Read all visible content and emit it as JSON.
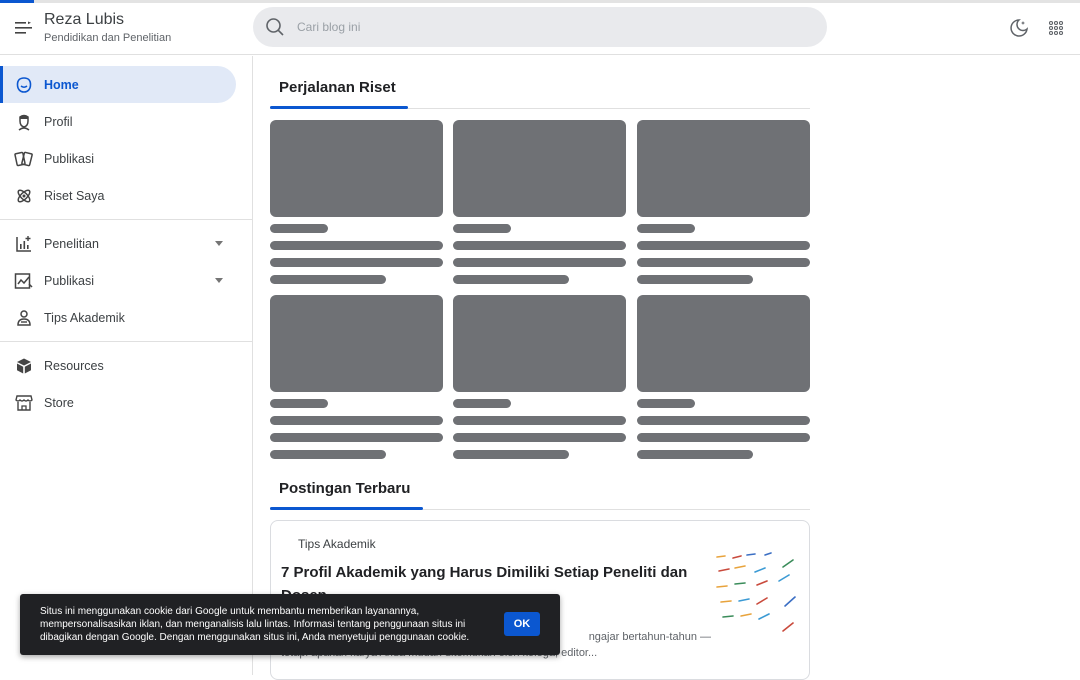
{
  "header": {
    "site_title": "Reza Lubis",
    "site_subtitle": "Pendidikan dan Penelitian",
    "search_placeholder": "Cari blog ini"
  },
  "sidebar": {
    "items": [
      {
        "label": "Home",
        "icon": "home-icon",
        "active": true
      },
      {
        "label": "Profil",
        "icon": "person-icon"
      },
      {
        "label": "Publikasi",
        "icon": "cards-icon"
      },
      {
        "label": "Riset Saya",
        "icon": "atom-icon"
      },
      {
        "label": "Penelitian",
        "icon": "chart-add-icon",
        "expandable": true
      },
      {
        "label": "Publikasi",
        "icon": "trend-chart-icon",
        "expandable": true
      },
      {
        "label": "Tips Akademik",
        "icon": "teacher-icon"
      },
      {
        "label": "Resources",
        "icon": "box-icon"
      },
      {
        "label": "Store",
        "icon": "store-icon"
      }
    ]
  },
  "main": {
    "section1_title": "Perjalanan Riset",
    "section2_title": "Postingan Terbaru",
    "post": {
      "category": "Tips Akademik",
      "title": "7 Profil Akademik yang Harus Dimiliki Setiap Peneliti dan Dosen",
      "snippet_line1": "ngajar bertahun-tahun —",
      "snippet_line2": "tetapi apakah karya Anda mudah ditemukan oleh kolega, editor..."
    }
  },
  "cookie": {
    "message": "Situs ini menggunakan cookie dari Google untuk membantu memberikan layanannya, mempersonalisasikan iklan, dan menganalisis lalu lintas. Informasi tentang penggunaan situs ini dibagikan dengan Google. Dengan menggunakan situs ini, Anda menyetujui penggunaan cookie.",
    "ok_label": "OK"
  },
  "colors": {
    "accent": "#0b57d0",
    "skeleton": "#6f7175",
    "active_bg": "#e1e9f7"
  }
}
